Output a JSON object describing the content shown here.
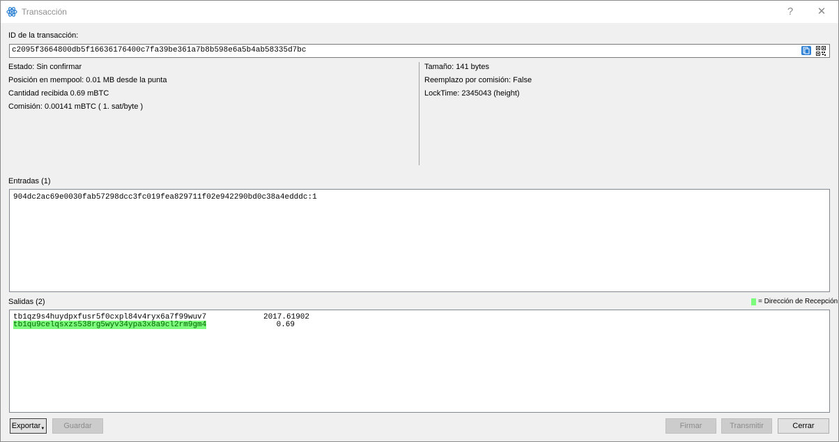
{
  "window": {
    "title": "Transacción",
    "help_label": "?",
    "close_label": "✕"
  },
  "txid": {
    "label": "ID de la transacción:",
    "value": "c2095f3664800db5f16636176400c7fa39be361a7b8b598e6a5b4ab58335d7bc"
  },
  "details_left": {
    "status": "Estado: Sin confirmar",
    "mempool": "Posición en mempool: 0.01 MB desde la punta",
    "received": "Cantidad recibida 0.69 mBTC",
    "fee": "Comisión: 0.00141 mBTC  ( 1. sat/byte )"
  },
  "details_right": {
    "size": "Tamaño: 141 bytes",
    "rbf": "Reemplazo por comisión: False",
    "locktime": "LockTime: 2345043 (height)"
  },
  "inputs": {
    "label": "Entradas (1)",
    "items": [
      "904dc2ac69e0030fab57298dcc3fc019fea829711f02e942290bd0c38a4edddc:1"
    ]
  },
  "outputs": {
    "label": "Salidas (2)",
    "legend": "= Dirección de Recepción",
    "items": [
      {
        "address": "tb1qz9s4huydpxfusr5f0cxpl84v4ryx6a7f99wuv7",
        "amount": "2017.61902",
        "is_mine": false
      },
      {
        "address": "tb1qu9celqsxzs538rg5wyv34ypa3x8a9cl2rm9gm4",
        "amount": "0.69",
        "is_mine": true
      }
    ]
  },
  "buttons": {
    "export": "Exportar",
    "save": "Guardar",
    "sign": "Firmar",
    "broadcast": "Transmitir",
    "close": "Cerrar"
  },
  "colors": {
    "own_address_highlight": "#7dfb7d",
    "copy_icon": "#2a7fd4"
  },
  "icons": {
    "app": "electrum-atom-icon",
    "copy": "copy-icon",
    "qr": "qr-code-icon",
    "dropdown": "dropdown-arrow-icon"
  }
}
